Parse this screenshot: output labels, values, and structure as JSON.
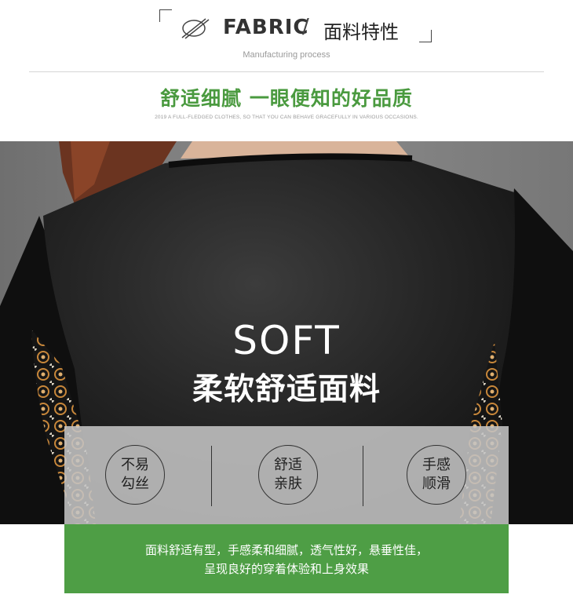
{
  "header": {
    "icon": "fabric-slash-circle-icon",
    "title_en": "FABRIC",
    "separator": "/",
    "title_cn": "面料特性",
    "subtitle": "Manufacturing process",
    "slogan": "舒适细腻 一眼便知的好品质",
    "tagline": "2019 A FULL-FLEDGED CLOTHES, SO THAT YOU CAN BEHAVE GRACEFULLY IN VARIOUS OCCASIONS."
  },
  "hero": {
    "title": "SOFT",
    "subtitle": "柔软舒适面料"
  },
  "features": [
    {
      "label": "不易勾丝"
    },
    {
      "label": "舒适亲肤"
    },
    {
      "label": "手感顺滑"
    }
  ],
  "description": {
    "line1": "面料舒适有型，手感柔和细腻，透气性好，悬垂性佳，",
    "line2": "呈现良好的穿着体验和上身效果"
  },
  "colors": {
    "accent_green": "#4a9a3f",
    "band_green": "#4e9e45",
    "print_orange": "#c8873a"
  }
}
